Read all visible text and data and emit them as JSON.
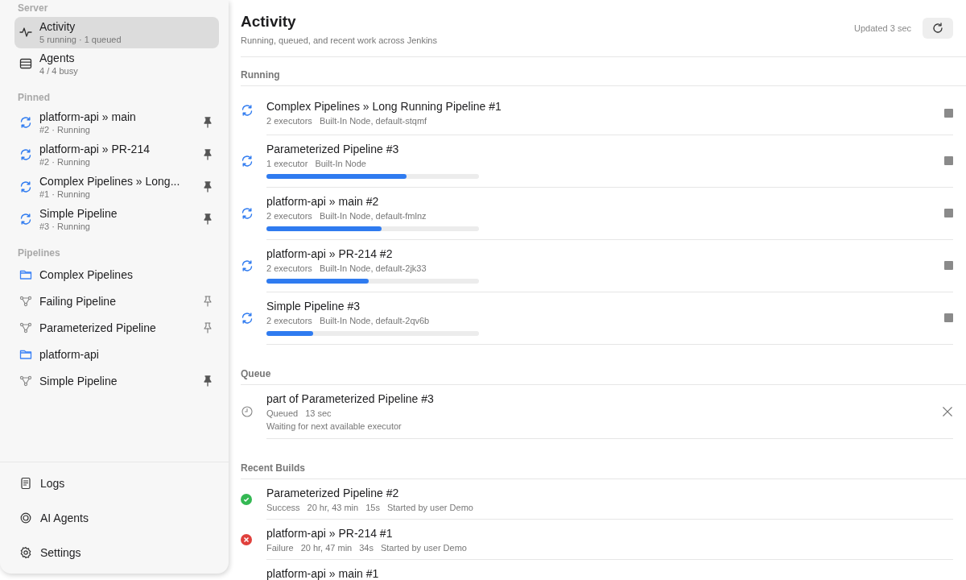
{
  "sidebar": {
    "sections": [
      {
        "title": "Server",
        "items": [
          {
            "kind": "activity",
            "label": "Activity",
            "sub": "5 running · 1 queued",
            "selected": true
          },
          {
            "kind": "agents",
            "label": "Agents",
            "sub": "4 / 4 busy",
            "selected": false
          }
        ]
      },
      {
        "title": "Pinned",
        "items": [
          {
            "kind": "job",
            "label": "platform-api » main",
            "sub": "#2 · Running",
            "pinned": true
          },
          {
            "kind": "job",
            "label": "platform-api » PR-214",
            "sub": "#2 · Running",
            "pinned": true
          },
          {
            "kind": "job",
            "label": "Complex Pipelines » Long...",
            "sub": "#1 · Running",
            "pinned": true
          },
          {
            "kind": "job",
            "label": "Simple Pipeline",
            "sub": "#3 · Running",
            "pinned": true
          }
        ]
      },
      {
        "title": "Pipelines",
        "items": [
          {
            "kind": "folder",
            "label": "Complex Pipelines"
          },
          {
            "kind": "pipeline",
            "label": "Failing Pipeline",
            "pinned": false
          },
          {
            "kind": "pipeline",
            "label": "Parameterized Pipeline",
            "pinned": false
          },
          {
            "kind": "folder",
            "label": "platform-api"
          },
          {
            "kind": "pipeline",
            "label": "Simple Pipeline",
            "pinned": true
          }
        ]
      }
    ],
    "footer": [
      {
        "kind": "logs",
        "label": "Logs"
      },
      {
        "kind": "ai",
        "label": "AI Agents"
      },
      {
        "kind": "settings",
        "label": "Settings"
      }
    ]
  },
  "header": {
    "title": "Activity",
    "subtitle": "Running, queued, and recent work across Jenkins",
    "updated": "Updated 3 sec"
  },
  "running": {
    "title": "Running",
    "items": [
      {
        "name": "Complex Pipelines » Long Running Pipeline #1",
        "executors": "2 executors",
        "node": "Built-In Node, default-stqmf"
      },
      {
        "name": "Parameterized Pipeline #3",
        "executors": "1 executor",
        "node": "Built-In Node",
        "level": 0.66
      },
      {
        "name": "platform-api » main #2",
        "executors": "2 executors",
        "node": "Built-In Node, default-fmlnz",
        "level": 0.54
      },
      {
        "name": "platform-api » PR-214 #2",
        "executors": "2 executors",
        "node": "Built-In Node, default-2jk33",
        "level": 0.48
      },
      {
        "name": "Simple Pipeline #3",
        "executors": "2 executors",
        "node": "Built-In Node, default-2qv6b",
        "level": 0.22
      }
    ]
  },
  "queue": {
    "title": "Queue",
    "items": [
      {
        "name": "part of Parameterized Pipeline #3",
        "status": "Queued",
        "time": "13 sec",
        "note": "Waiting for next available executor"
      }
    ]
  },
  "recent": {
    "title": "Recent Builds",
    "items": [
      {
        "kind": "success",
        "name": "Parameterized Pipeline #2",
        "status": "Success",
        "ago": "20 hr, 43 min",
        "duration": "15s",
        "cause": "Started by user Demo"
      },
      {
        "kind": "failure",
        "name": "platform-api » PR-214 #1",
        "status": "Failure",
        "ago": "20 hr, 47 min",
        "duration": "34s",
        "cause": "Started by user Demo"
      },
      {
        "name": "platform-api » main #1"
      }
    ]
  }
}
